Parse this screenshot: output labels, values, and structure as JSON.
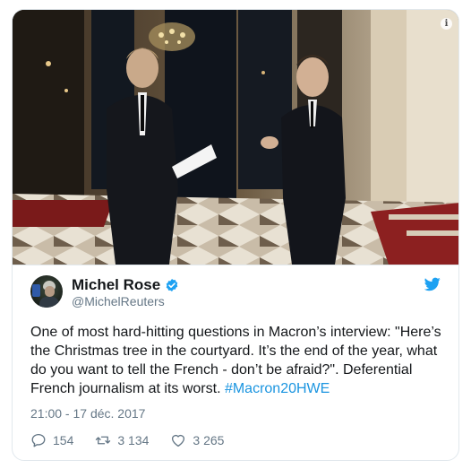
{
  "tweet": {
    "author_name": "Michel Rose",
    "author_handle": "@MichelReuters",
    "text_main": "One of most hard-hitting questions in Macron’s interview: \"Here’s the Christmas tree in the courtyard. It’s the end of the year, what do you want to tell the French - don’t be afraid?\". Deferential French journalism at its worst. ",
    "hashtag": "#Macron20HWE",
    "timestamp": "21:00 - 17 déc. 2017"
  },
  "actions": {
    "replies": "154",
    "retweets": "3 134",
    "likes": "3 265"
  },
  "icons": {
    "verified": "verified-badge-icon",
    "brand": "twitter-bird-icon",
    "info": "info-icon",
    "reply": "reply-icon",
    "retweet": "retweet-icon",
    "like": "heart-icon"
  },
  "colors": {
    "accent": "#1da1f2",
    "hashtag": "#1b95e0",
    "secondary_text": "#657786",
    "border": "#e1e8ed"
  }
}
